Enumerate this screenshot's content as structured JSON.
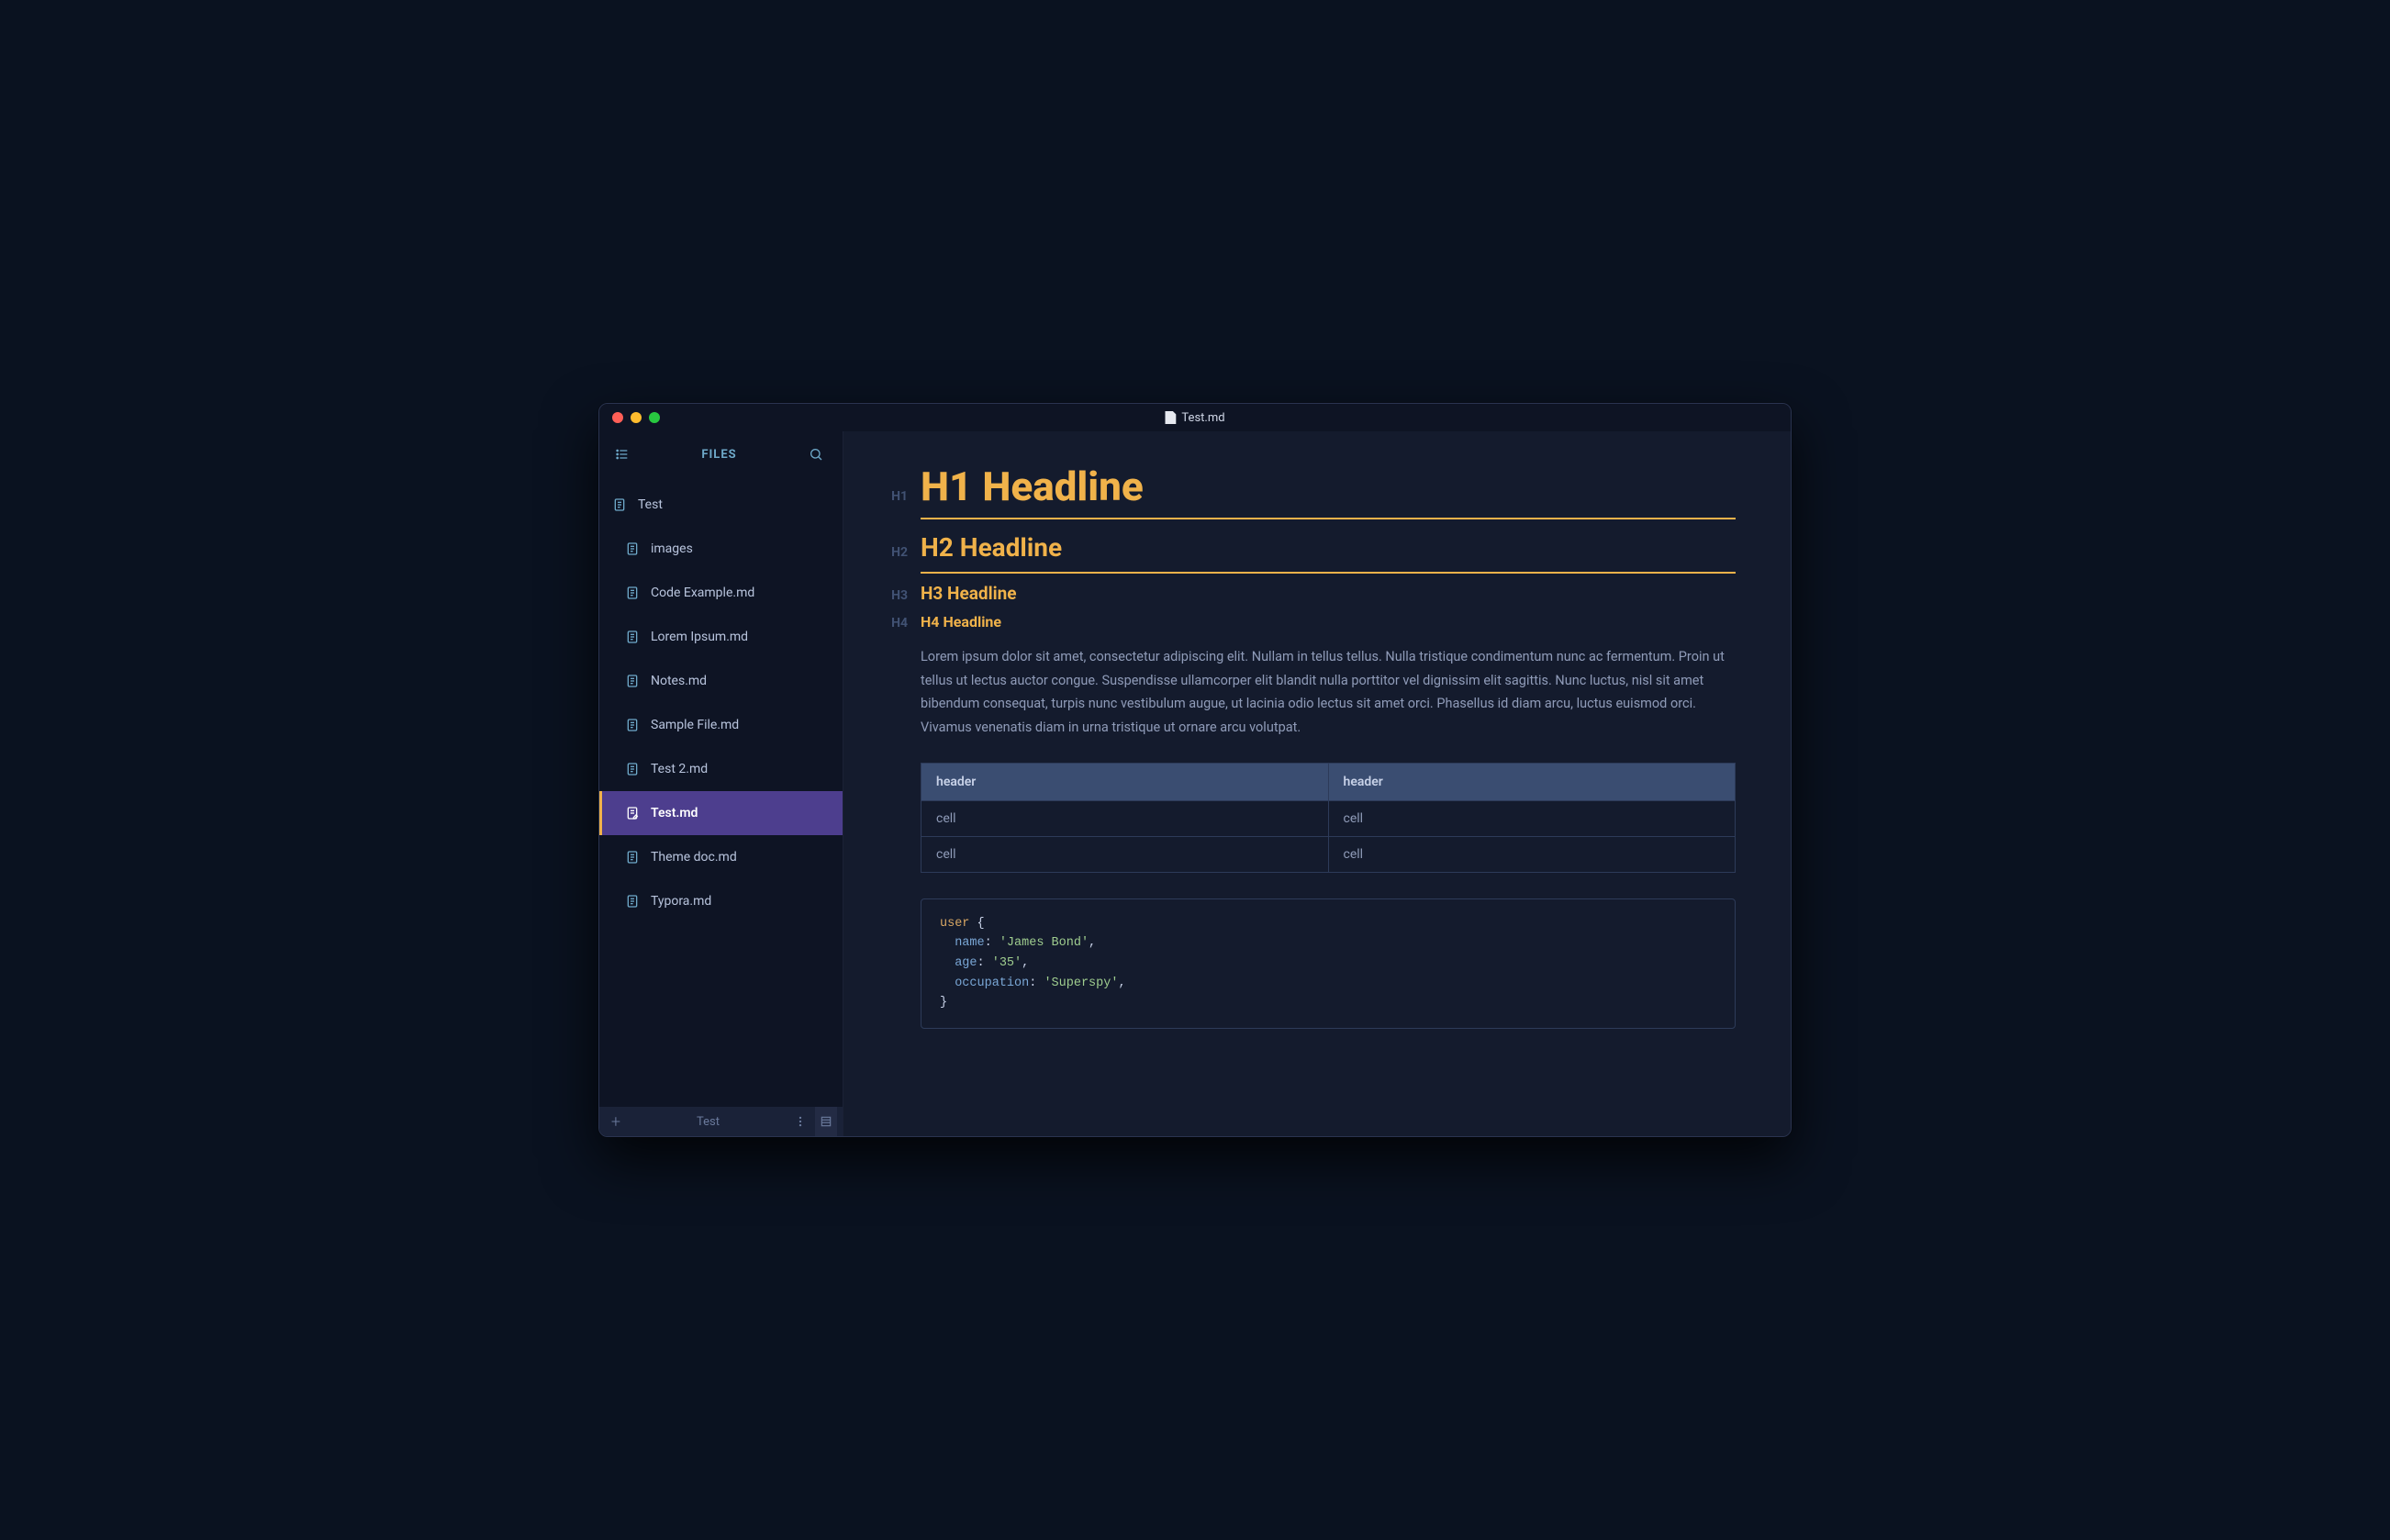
{
  "window": {
    "title": "Test.md"
  },
  "sidebar": {
    "title": "FILES",
    "items": [
      {
        "label": "Test",
        "indent": 0,
        "active": false,
        "is_open": true
      },
      {
        "label": "images",
        "indent": 1,
        "active": false
      },
      {
        "label": "Code Example.md",
        "indent": 1,
        "active": false
      },
      {
        "label": "Lorem Ipsum.md",
        "indent": 1,
        "active": false
      },
      {
        "label": "Notes.md",
        "indent": 1,
        "active": false
      },
      {
        "label": "Sample File.md",
        "indent": 1,
        "active": false
      },
      {
        "label": "Test 2.md",
        "indent": 1,
        "active": false
      },
      {
        "label": "Test.md",
        "indent": 1,
        "active": true
      },
      {
        "label": "Theme doc.md",
        "indent": 1,
        "active": false
      },
      {
        "label": "Typora.md",
        "indent": 1,
        "active": false
      }
    ],
    "footer": {
      "folder": "Test"
    }
  },
  "document": {
    "h1_marker": "H1",
    "h1": "H1 Headline",
    "h2_marker": "H2",
    "h2": "H2 Headline",
    "h3_marker": "H3",
    "h3": "H3 Headline",
    "h4_marker": "H4",
    "h4": "H4 Headline",
    "paragraph": "Lorem ipsum dolor sit amet, consectetur adipiscing elit. Nullam in tellus tellus. Nulla tristique condimentum nunc ac fermentum. Proin ut tellus ut lectus auctor congue. Suspendisse ullamcorper elit blandit nulla porttitor vel dignissim elit sagittis. Nunc luctus, nisl sit amet bibendum consequat, turpis nunc vestibulum augue, ut lacinia odio lectus sit amet orci. Phasellus id diam arcu, luctus euismod orci. Vivamus venenatis diam in urna tristique ut ornare arcu volutpat.",
    "table": {
      "headers": [
        "header",
        "header"
      ],
      "rows": [
        [
          "cell",
          "cell"
        ],
        [
          "cell",
          "cell"
        ]
      ]
    },
    "code": {
      "ident": "user",
      "entries": [
        {
          "key": "name",
          "value": "'James Bond'"
        },
        {
          "key": "age",
          "value": "'35'"
        },
        {
          "key": "occupation",
          "value": "'Superspy'"
        }
      ]
    }
  },
  "colors": {
    "accent": "#f0b24a",
    "sidebar_active": "#4d3e8e"
  }
}
